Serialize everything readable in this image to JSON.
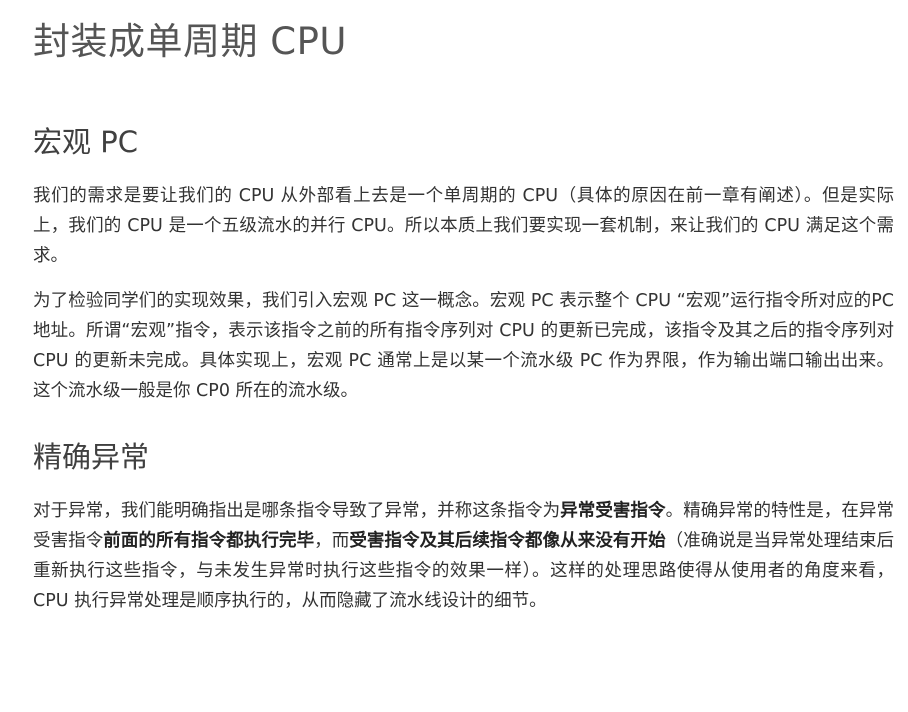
{
  "title": "封装成单周期 CPU",
  "sections": [
    {
      "heading": "宏观 PC",
      "paragraphs": [
        "我们的需求是要让我们的 CPU 从外部看上去是一个单周期的 CPU（具体的原因在前一章有阐述）。但是实际上，我们的 CPU 是一个五级流水的并行 CPU。所以本质上我们要实现一套机制，来让我们的 CPU 满足这个需求。",
        "为了检验同学们的实现效果，我们引入宏观 PC 这一概念。宏观 PC 表示整个 CPU “宏观”运行指令所对应的PC地址。所谓“宏观”指令，表示该指令之前的所有指令序列对 CPU 的更新已完成，该指令及其之后的指令序列对 CPU 的更新未完成。具体实现上，宏观 PC 通常上是以某一个流水级 PC 作为界限，作为输出端口输出出来。这个流水级一般是你 CP0 所在的流水级。"
      ]
    },
    {
      "heading": "精确异常",
      "paragraph": {
        "part1": "对于异常，我们能明确指出是哪条指令导致了异常，并称这条指令为",
        "bold1": "异常受害指令",
        "part2": "。精确异常的特性是，在异常受害指令",
        "bold2": "前面的所有指令都执行完毕",
        "part3": "，而",
        "bold3": "受害指令及其后续指令都像从来没有开始",
        "part4": "（准确说是当异常处理结束后重新执行这些指令，与未发生异常时执行这些指令的效果一样）。这样的处理思路使得从使用者的角度来看， CPU 执行异常处理是顺序执行的，从而隐藏了流水线设计的细节。"
      }
    }
  ]
}
